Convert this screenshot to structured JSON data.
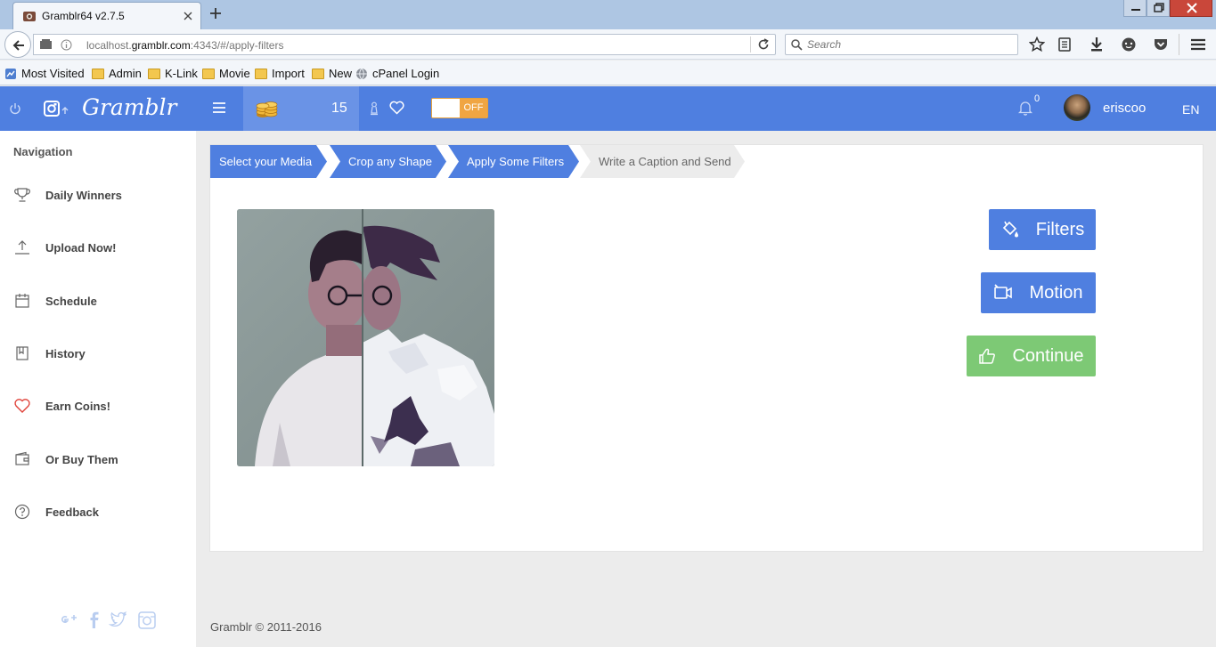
{
  "browser": {
    "tab_title": "Gramblr64 v2.7.5",
    "url_host_prefix": "localhost.",
    "url_host_main": "gramblr.com",
    "url_rest": ":4343/#/apply-filters",
    "search_placeholder": "Search",
    "bookmarks": [
      "Most Visited",
      "Admin",
      "K-Link",
      "Movie",
      "Import",
      "New",
      "cPanel Login"
    ]
  },
  "header": {
    "brand": "Gramblr",
    "coin_count": "15",
    "toggle_label": "OFF",
    "notification_count": "0",
    "username": "eriscoo",
    "language": "EN"
  },
  "sidebar": {
    "title": "Navigation",
    "items": [
      {
        "label": "Daily Winners",
        "icon": "trophy-icon"
      },
      {
        "label": "Upload Now!",
        "icon": "upload-icon"
      },
      {
        "label": "Schedule",
        "icon": "calendar-icon"
      },
      {
        "label": "History",
        "icon": "bookmark-icon"
      },
      {
        "label": "Earn Coins!",
        "icon": "heart-icon"
      },
      {
        "label": "Or Buy Them",
        "icon": "wallet-icon"
      },
      {
        "label": "Feedback",
        "icon": "help-icon"
      }
    ]
  },
  "wizard": {
    "steps": [
      {
        "label": "Select your Media",
        "state": "done"
      },
      {
        "label": "Crop any Shape",
        "state": "done"
      },
      {
        "label": "Apply Some Filters",
        "state": "active"
      },
      {
        "label": "Write a Caption and Send",
        "state": "pending"
      }
    ]
  },
  "actions": {
    "filters": "Filters",
    "motion": "Motion",
    "continue": "Continue"
  },
  "footer": {
    "copyright": "Gramblr © 2011-2016"
  },
  "colors": {
    "header": "#4f7fe0",
    "primary_button": "#4f7fe0",
    "success_button": "#7dc975",
    "accent_orange": "#f0a542"
  }
}
